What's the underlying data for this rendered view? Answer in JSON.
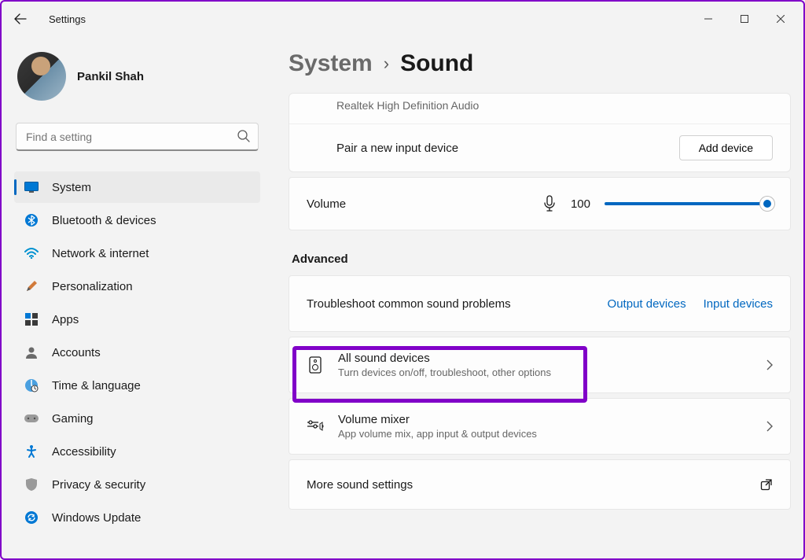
{
  "window": {
    "title": "Settings"
  },
  "profile": {
    "name": "Pankil Shah"
  },
  "search": {
    "placeholder": "Find a setting"
  },
  "nav": {
    "items": [
      {
        "id": "system",
        "label": "System",
        "selected": true
      },
      {
        "id": "bluetooth",
        "label": "Bluetooth & devices"
      },
      {
        "id": "network",
        "label": "Network & internet"
      },
      {
        "id": "personalization",
        "label": "Personalization"
      },
      {
        "id": "apps",
        "label": "Apps"
      },
      {
        "id": "accounts",
        "label": "Accounts"
      },
      {
        "id": "time",
        "label": "Time & language"
      },
      {
        "id": "gaming",
        "label": "Gaming"
      },
      {
        "id": "accessibility",
        "label": "Accessibility"
      },
      {
        "id": "privacy",
        "label": "Privacy & security"
      },
      {
        "id": "update",
        "label": "Windows Update"
      }
    ]
  },
  "breadcrumb": {
    "parent": "System",
    "current": "Sound"
  },
  "input_device": {
    "name": "Realtek High Definition Audio"
  },
  "pair": {
    "label": "Pair a new input device",
    "button": "Add device"
  },
  "volume": {
    "label": "Volume",
    "value": "100"
  },
  "advanced": {
    "heading": "Advanced",
    "troubleshoot": {
      "label": "Troubleshoot common sound problems",
      "output": "Output devices",
      "input": "Input devices"
    },
    "all_devices": {
      "title": "All sound devices",
      "sub": "Turn devices on/off, troubleshoot, other options"
    },
    "mixer": {
      "title": "Volume mixer",
      "sub": "App volume mix, app input & output devices"
    },
    "more": {
      "title": "More sound settings"
    }
  }
}
